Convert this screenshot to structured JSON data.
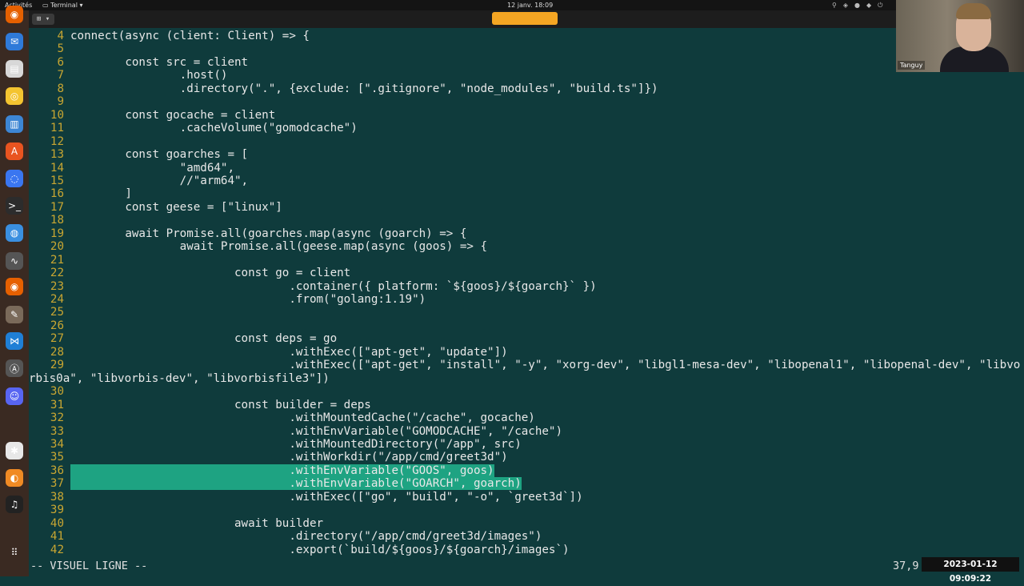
{
  "topbar": {
    "activities": "Activités",
    "app_name": "Terminal",
    "clock": "12 janv. 18:09"
  },
  "dock": {
    "apps": [
      {
        "icon": "firefox-icon",
        "color": "#e66000"
      },
      {
        "icon": "thunderbird-icon",
        "color": "#2f7ad9"
      },
      {
        "icon": "files-icon",
        "color": "#d8d8d8"
      },
      {
        "icon": "rhythmbox-icon",
        "color": "#f4c430"
      },
      {
        "icon": "writer-icon",
        "color": "#3d86d4"
      },
      {
        "icon": "app-center-icon",
        "color": "#e95420"
      },
      {
        "icon": "signal-icon",
        "color": "#3a76f0"
      },
      {
        "icon": "terminal-icon",
        "color": "#2c2c2c"
      },
      {
        "icon": "chromium-icon",
        "color": "#3a8fe0"
      },
      {
        "icon": "system-monitor-icon",
        "color": "#555555"
      },
      {
        "icon": "firefox-dev-icon",
        "color": "#e66000"
      },
      {
        "icon": "gimp-icon",
        "color": "#7a6a5a"
      },
      {
        "icon": "vscode-icon",
        "color": "#1f7fd6"
      },
      {
        "icon": "software-icon",
        "color": "#555555"
      },
      {
        "icon": "discord-icon",
        "color": "#5865f2"
      },
      {
        "icon": "slack-icon",
        "color": "#e8e8e8"
      },
      {
        "icon": "blender-icon",
        "color": "#f08a24"
      },
      {
        "icon": "music-icon",
        "color": "#222222"
      },
      {
        "icon": "app-grid-icon",
        "color": "#3a2a22"
      }
    ]
  },
  "editor": {
    "lines": [
      {
        "num": "4",
        "text": "connect(async (client: Client) => {"
      },
      {
        "num": "5",
        "text": ""
      },
      {
        "num": "6",
        "text": "        const src = client"
      },
      {
        "num": "7",
        "text": "                .host()"
      },
      {
        "num": "8",
        "text": "                .directory(\".\", {exclude: [\".gitignore\", \"node_modules\", \"build.ts\"]})"
      },
      {
        "num": "9",
        "text": ""
      },
      {
        "num": "10",
        "text": "        const gocache = client"
      },
      {
        "num": "11",
        "text": "                .cacheVolume(\"gomodcache\")"
      },
      {
        "num": "12",
        "text": ""
      },
      {
        "num": "13",
        "text": "        const goarches = ["
      },
      {
        "num": "14",
        "text": "                \"amd64\","
      },
      {
        "num": "15",
        "text": "                //\"arm64\","
      },
      {
        "num": "16",
        "text": "        ]"
      },
      {
        "num": "17",
        "text": "        const geese = [\"linux\"]"
      },
      {
        "num": "18",
        "text": ""
      },
      {
        "num": "19",
        "text": "        await Promise.all(goarches.map(async (goarch) => {"
      },
      {
        "num": "20",
        "text": "                await Promise.all(geese.map(async (goos) => {"
      },
      {
        "num": "21",
        "text": ""
      },
      {
        "num": "22",
        "text": "                        const go = client"
      },
      {
        "num": "23",
        "text": "                                .container({ platform: `${goos}/${goarch}` })"
      },
      {
        "num": "24",
        "text": "                                .from(\"golang:1.19\")"
      },
      {
        "num": "25",
        "text": ""
      },
      {
        "num": "26",
        "text": ""
      },
      {
        "num": "27",
        "text": "                        const deps = go"
      },
      {
        "num": "28",
        "text": "                                .withExec([\"apt-get\", \"update\"])"
      },
      {
        "num": "29",
        "text": "                                .withExec([\"apt-get\", \"install\", \"-y\", \"xorg-dev\", \"libgl1-mesa-dev\", \"libopenal1\", \"libopenal-dev\", \"libvo"
      },
      {
        "num": "",
        "text": "rbis0a\", \"libvorbis-dev\", \"libvorbisfile3\"])"
      },
      {
        "num": "30",
        "text": ""
      },
      {
        "num": "31",
        "text": "                        const builder = deps"
      },
      {
        "num": "32",
        "text": "                                .withMountedCache(\"/cache\", gocache)"
      },
      {
        "num": "33",
        "text": "                                .withEnvVariable(\"GOMODCACHE\", \"/cache\")"
      },
      {
        "num": "34",
        "text": "                                .withMountedDirectory(\"/app\", src)"
      },
      {
        "num": "35",
        "text": "                                .withWorkdir(\"/app/cmd/greet3d\")"
      },
      {
        "num": "36",
        "text": "                                .withEnvVariable(\"GOOS\", goos)"
      },
      {
        "num": "37",
        "text": "                                .withEnvVariable(\"GOARCH\", goarch)"
      },
      {
        "num": "38",
        "text": "                                .withExec([\"go\", \"build\", \"-o\", `greet3d`])"
      },
      {
        "num": "39",
        "text": ""
      },
      {
        "num": "40",
        "text": "                        await builder"
      },
      {
        "num": "41",
        "text": "                                .directory(\"/app/cmd/greet3d/images\")"
      },
      {
        "num": "42",
        "text": "                                .export(`build/${goos}/${goarch}/images`)"
      }
    ],
    "highlighted": [
      "36",
      "37"
    ]
  },
  "statusline": {
    "mode": "-- VISUEL LIGNE --",
    "position": "37,9"
  },
  "overlay": {
    "timestamp": "2023-01-12 09:09:22",
    "webcam_name": "Tanguy"
  }
}
